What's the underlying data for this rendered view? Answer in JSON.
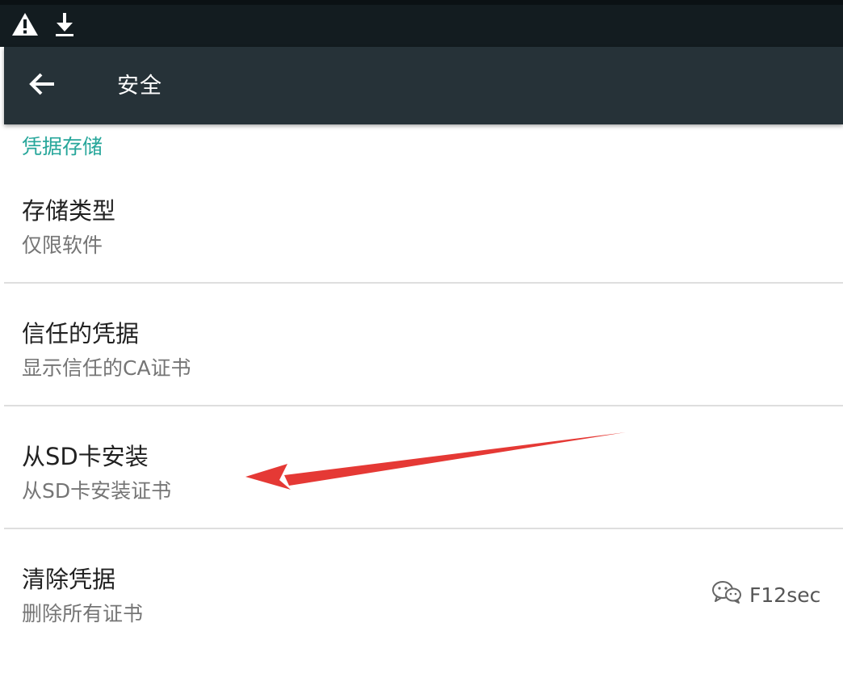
{
  "status_bar": {
    "icons": [
      "warning-icon",
      "download-icon"
    ]
  },
  "app_bar": {
    "back_icon": "arrow-back-icon",
    "title": "安全"
  },
  "section": {
    "header": "凭据存储"
  },
  "items": [
    {
      "title": "存储类型",
      "summary": "仅限软件"
    },
    {
      "title": "信任的凭据",
      "summary": "显示信任的CA证书"
    },
    {
      "title": "从SD卡安装",
      "summary": "从SD卡安装证书"
    },
    {
      "title": "清除凭据",
      "summary": "删除所有证书"
    }
  ],
  "annotation": {
    "color": "#e53935",
    "points_to": "从SD卡安装"
  },
  "watermark": {
    "icon": "wechat-icon",
    "text": "F12sec"
  }
}
